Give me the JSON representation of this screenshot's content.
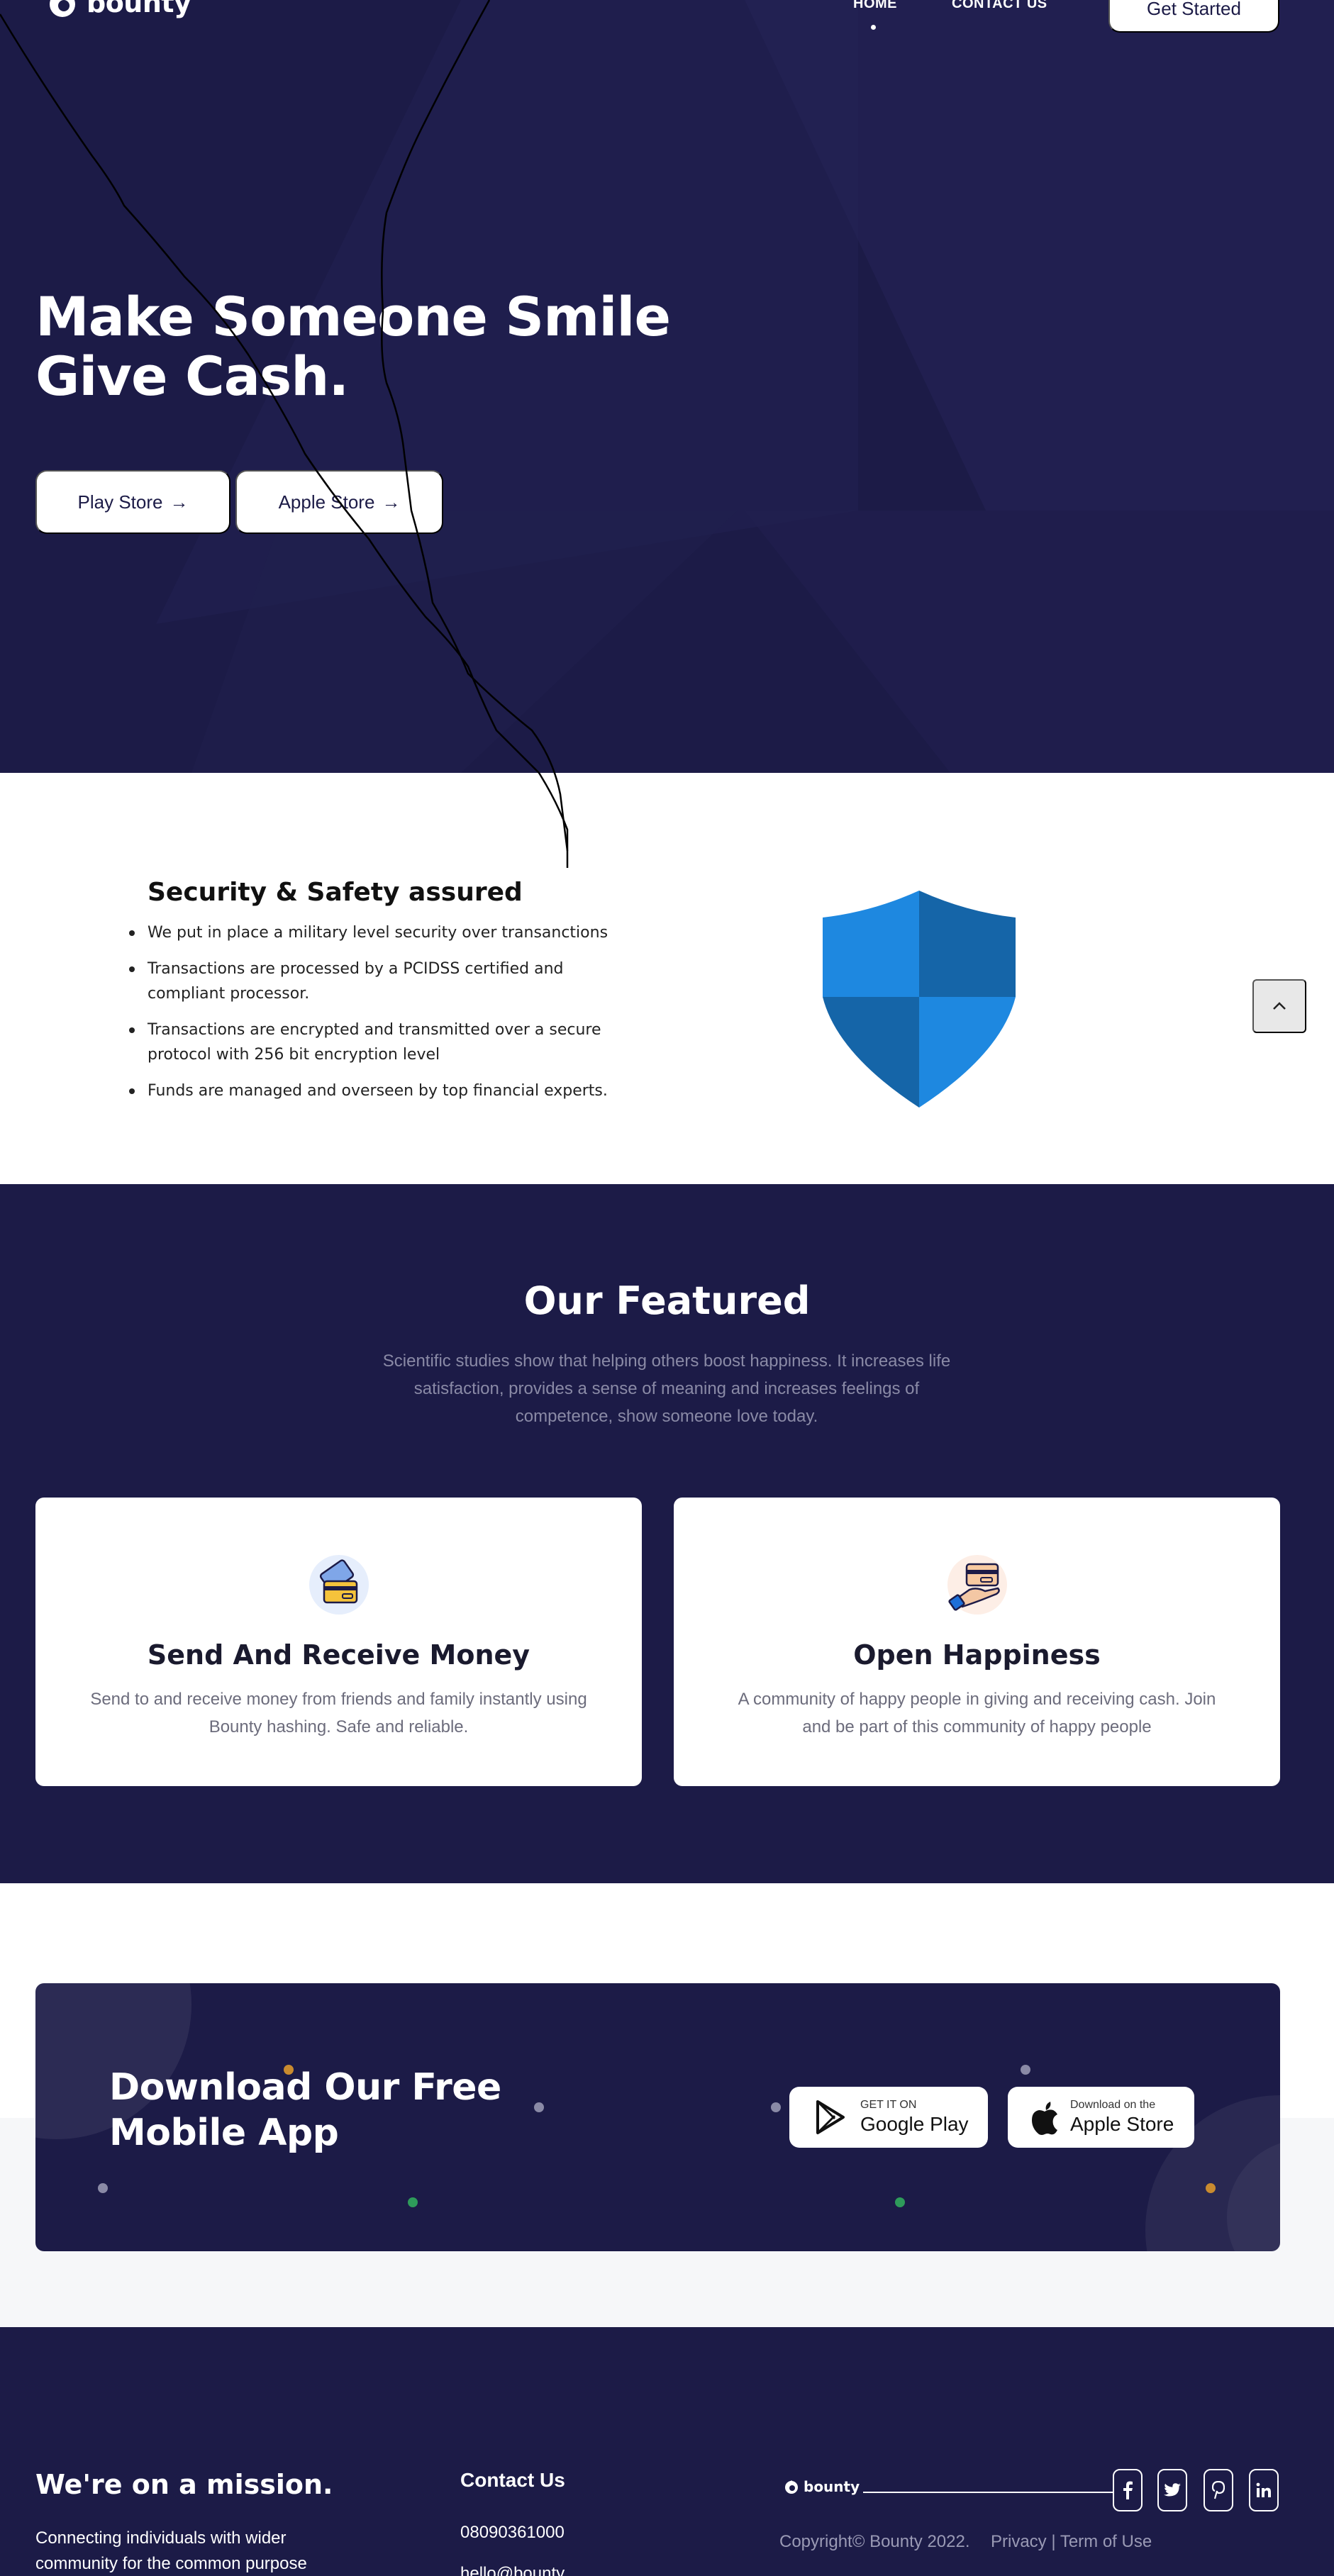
{
  "brand": {
    "name": "bounty"
  },
  "nav": {
    "home": "HOME",
    "contact": "CONTACT US",
    "cta": "Get Started"
  },
  "hero": {
    "title_line1": "Make Someone Smile",
    "title_line2": "Give Cash.",
    "play_store": "Play Store",
    "apple_store": "Apple Store",
    "arrow": "→"
  },
  "security": {
    "title": "Security & Safety assured",
    "items": [
      "We put in place a military level security over transanctions",
      "Transactions are processed by a PCIDSS certified and compliant processor.",
      "Transactions are encrypted and transmitted over a secure protocol with 256 bit encryption level",
      "Funds are managed and overseen by top financial experts."
    ]
  },
  "featured": {
    "title": "Our Featured",
    "description": "Scientific studies show that helping others boost happiness. It increases life satisfaction, provides a sense of meaning and increases feelings of competence, show someone love today.",
    "cards": [
      {
        "icon": "credit-cards-icon",
        "title": "Send And Receive Money",
        "description": "Send to and receive money from friends and family instantly using Bounty hashing. Safe and reliable."
      },
      {
        "icon": "hand-card-icon",
        "title": "Open Happiness",
        "description": "A community of happy people in giving and receiving cash. Join and be part of this community of happy people"
      }
    ]
  },
  "download": {
    "title_line1": "Download Our Free",
    "title_line2": "Mobile App",
    "google_small": "GET IT ON",
    "google_big": "Google Play",
    "apple_small": "Download on the",
    "apple_big": "Apple Store"
  },
  "footer": {
    "mission_title": "We're on a mission.",
    "mission_text": "Connecting individuals with wider community for the common purpose",
    "contact_title": "Contact Us",
    "phone": "08090361000",
    "email": "hello@bounty",
    "brand": "bounty",
    "copyright": "Copyright© Bounty 2022.",
    "legal": "Privacy | Term of Use",
    "social": [
      "facebook-icon",
      "twitter-icon",
      "pinterest-icon",
      "linkedin-icon"
    ]
  },
  "colors": {
    "navy": "#1c1b47",
    "shield_light": "#1e88e0",
    "shield_dark": "#1565a8"
  }
}
